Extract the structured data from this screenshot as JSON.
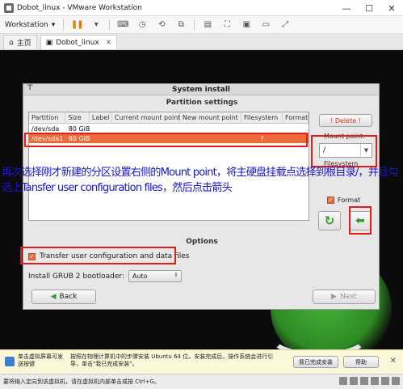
{
  "window": {
    "title": "Dobot_linux - VMware Workstation",
    "controls": {
      "minimize": "—",
      "maximize": "☐",
      "close": "✕"
    }
  },
  "toolbar": {
    "menu_label": "Workstation",
    "icons": [
      "pause-icon",
      "vm-icon",
      "screen-icon",
      "snapshot-icon",
      "revert-icon",
      "manage-icon",
      "fullscreen-icon",
      "unity-icon",
      "console-icon",
      "stretch-icon"
    ]
  },
  "tabs": [
    {
      "label": "主页",
      "icon": "home-icon"
    },
    {
      "label": "Dobot_linux",
      "icon": "vm-icon",
      "close": "✕"
    }
  ],
  "dialog": {
    "title": "System install",
    "section_partition": "Partition settings",
    "table": {
      "headers": [
        "Partition",
        "Size",
        "Label",
        "Current mount point",
        "New mount point",
        "Filesystem",
        "Format"
      ],
      "rows": [
        {
          "partition": "/dev/sda",
          "size": "80 GiB",
          "label": "",
          "current": "",
          "new": "",
          "fs": "",
          "format": ""
        },
        {
          "partition": "/dev/sda1",
          "size": "80 GiB",
          "label": "",
          "current": "",
          "new": "",
          "fs": "?",
          "format": ""
        }
      ],
      "selected_row": 1
    },
    "delete_label": "! Delete !",
    "mount_point_label": "Mount point:",
    "mount_point_value": "/",
    "filesystem_label": "Filesystem",
    "format_label": "Format",
    "format_checked": true,
    "section_options": "Options",
    "transfer_label": "Transfer user configuration and data files",
    "transfer_checked": true,
    "grub_label": "Install GRUB 2 bootloader:",
    "grub_value": "Auto",
    "back_label": "Back",
    "next_label": "Next"
  },
  "annotation": {
    "text": "再次选择刚才新建的分区设置右侧的Mount point，将主硬盘挂载点选择到根目录/，并且勾选上Tansfer user configuration files，然后点击箭头"
  },
  "hint": {
    "left": "单击虚拟屏幕可发送按键",
    "middle": "按照在物理计算机中的步骤安装 Ubuntu 64 位。安装完成后，操作系统会进行引导，单击\"我已完成安装\"。",
    "done_button": "我已完成安装",
    "help_button": "帮助"
  },
  "status": {
    "text": "要将输入定向到该虚拟机，请在虚拟机内部单击或按 Ctrl+G。"
  },
  "colors": {
    "selection": "#ef6a3a",
    "annotation_box": "#e21b1b",
    "annotation_text": "#1a17c9",
    "arrow_green": "#2e9d2e"
  }
}
